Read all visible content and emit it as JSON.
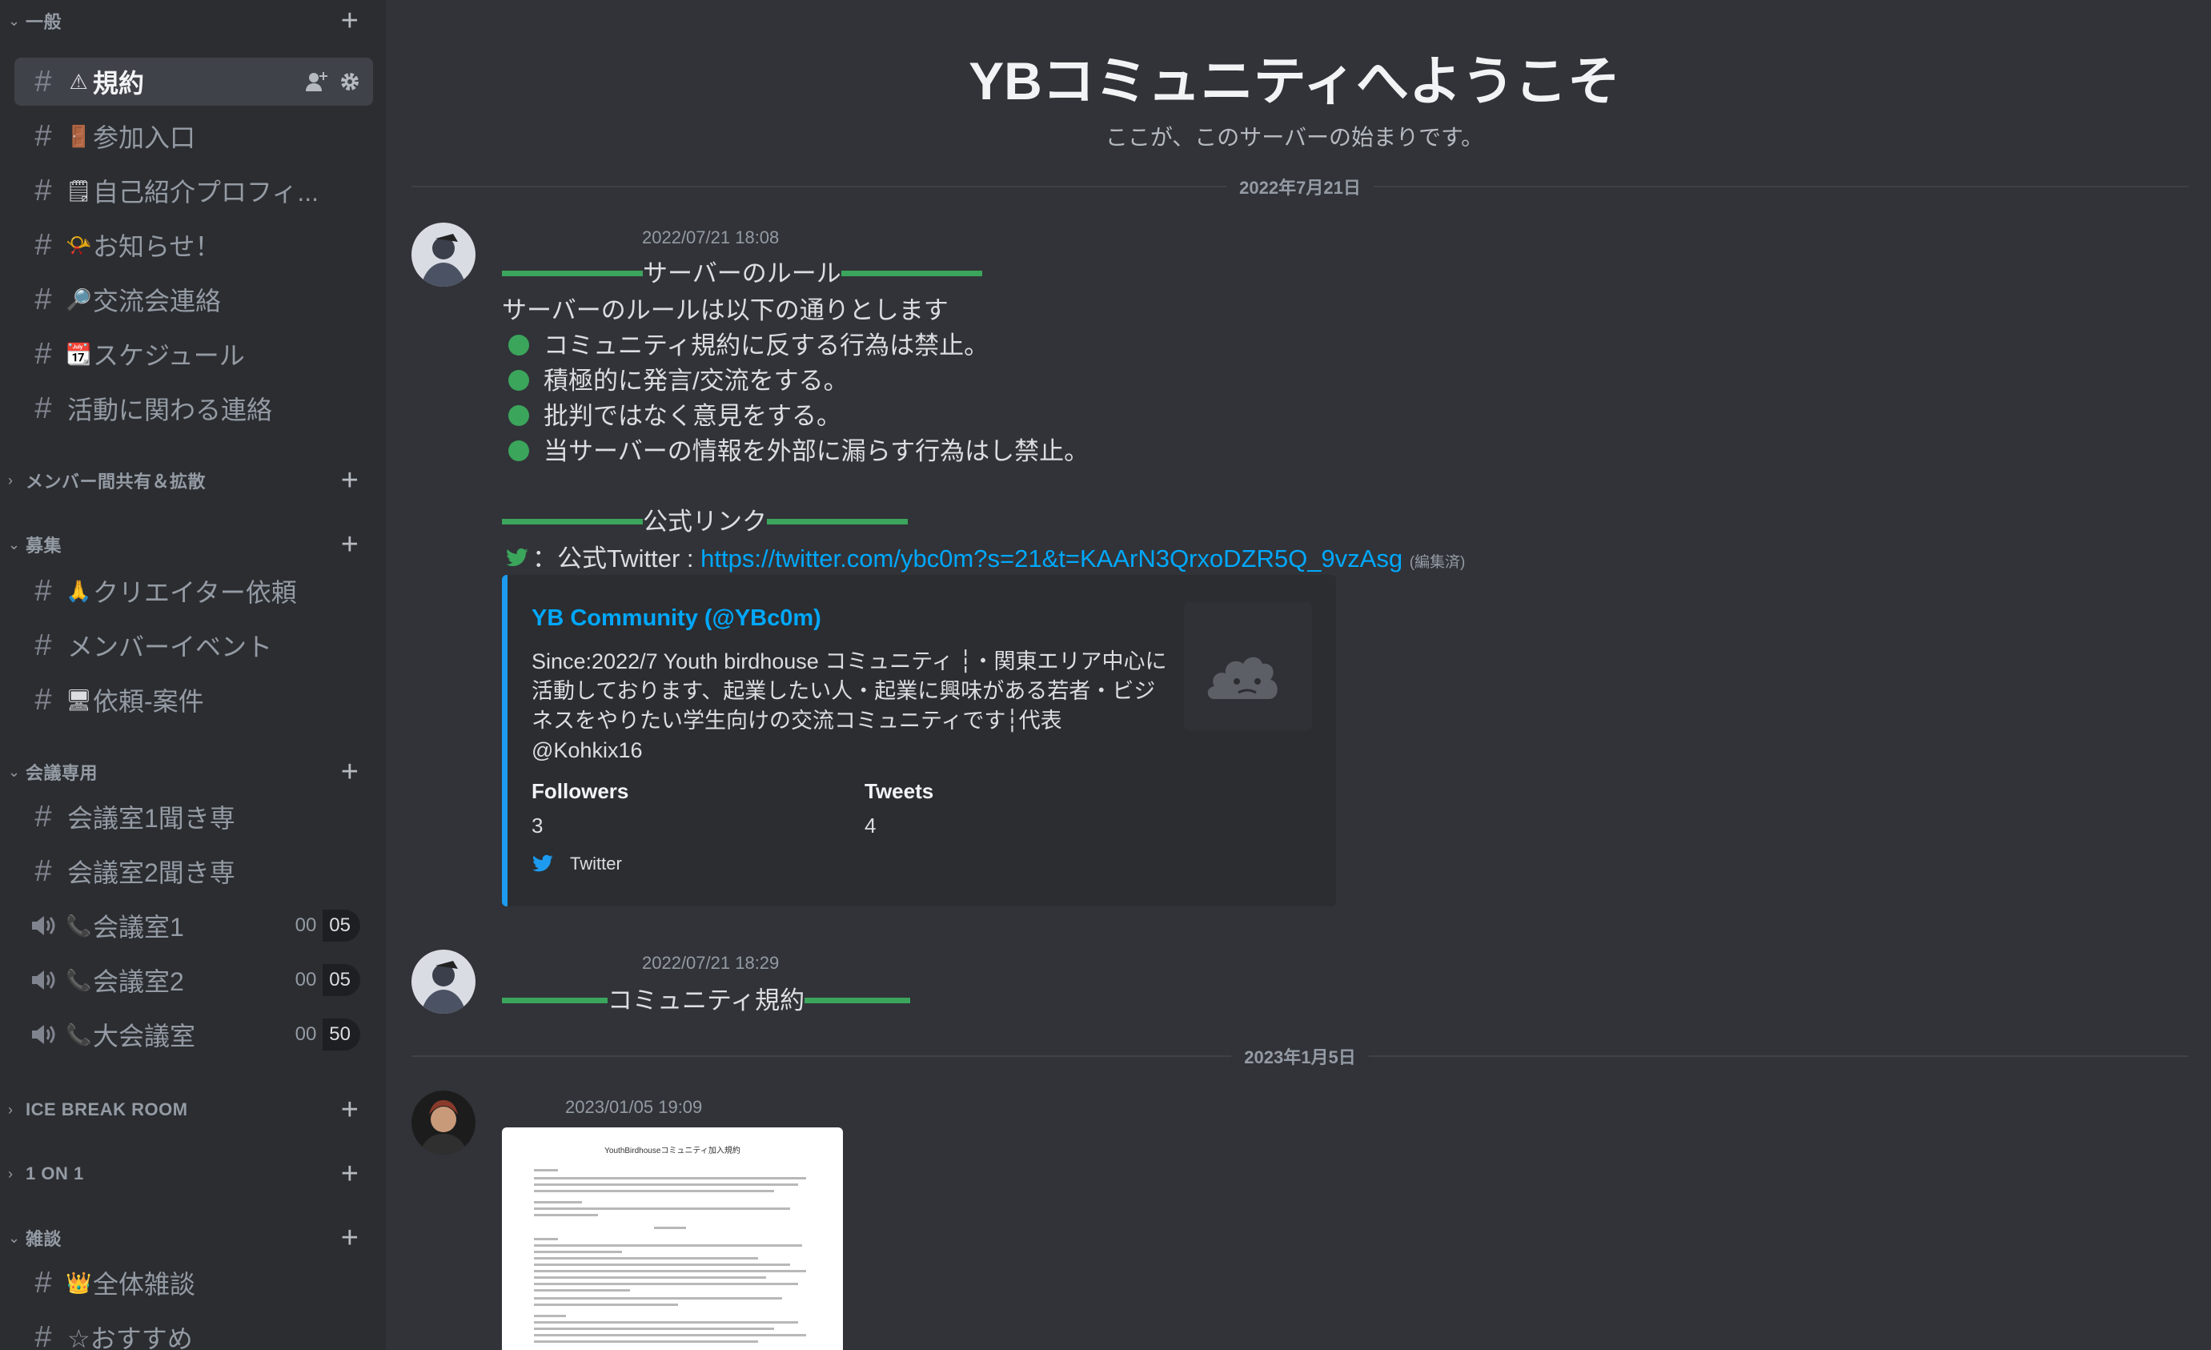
{
  "sidebar": {
    "categories": [
      {
        "label": "一般",
        "chev": "⌄"
      },
      {
        "label": "メンバー間共有＆拡散",
        "chev": "›"
      },
      {
        "label": "募集",
        "chev": "⌄"
      },
      {
        "label": "会議専用",
        "chev": "⌄"
      },
      {
        "label": "ICE BREAK ROOM",
        "chev": "›"
      },
      {
        "label": "1 ON 1",
        "chev": "›"
      },
      {
        "label": "雑談",
        "chev": "⌄"
      }
    ],
    "channels": [
      {
        "emoji": "⚠",
        "label": "規約"
      },
      {
        "emoji": "🚪",
        "label": "参加入口"
      },
      {
        "emoji": "🗒",
        "label": "自己紹介プロフィ..."
      },
      {
        "emoji": "📯",
        "label": "お知らせ！"
      },
      {
        "emoji": "🔎",
        "label": "交流会連絡"
      },
      {
        "emoji": "📆",
        "label": "スケジュール"
      },
      {
        "emoji": "",
        "label": "活動に関わる連絡"
      },
      {
        "emoji": "🙏",
        "label": "クリエイター依頼"
      },
      {
        "emoji": "",
        "label": "メンバーイベント"
      },
      {
        "emoji": "🖥",
        "label": "依頼-案件"
      },
      {
        "emoji": "",
        "label": "会議室1聞き専"
      },
      {
        "emoji": "",
        "label": "会議室2聞き専"
      },
      {
        "emoji": "📞",
        "label": "会議室1",
        "count_a": "00",
        "count_b": "05"
      },
      {
        "emoji": "📞",
        "label": "会議室2",
        "count_a": "00",
        "count_b": "05"
      },
      {
        "emoji": "📞",
        "label": "大会議室",
        "count_a": "00",
        "count_b": "50"
      },
      {
        "emoji": "👑",
        "label": "全体雑談"
      },
      {
        "emoji": "",
        "label": "☆おすすめ"
      }
    ],
    "hash_glyph": "#"
  },
  "main": {
    "welcome_title": "YBコミュニティへようこそ",
    "welcome_sub": "ここが、このサーバーの始まりです。",
    "date_dividers": [
      "2022年7月21日",
      "2023年1月5日"
    ],
    "messages": [
      {
        "timestamp": "2022/07/21 18:08",
        "rules_heading": "サーバーのルール",
        "rules_intro": "サーバーのルールは以下の通りとします",
        "rules": [
          "コミュニティ規約に反する行為は禁止。",
          "積極的に発言/交流をする。",
          "批判ではなく意見をする。",
          "当サーバーの情報を外部に漏らす行為はし禁止。"
        ],
        "links_heading": "公式リンク",
        "twitter_prefix": "：公式Twitter : ",
        "twitter_url": "https://twitter.com/ybc0m?s=21&t=KAArN3QrxoDZR5Q_9vzAsg",
        "edited": "(編集済)",
        "embed": {
          "author": "YB Community (@YBc0m)",
          "description": "Since:2022/7 Youth birdhouse コミュニティ ┆・関東エリア中心に活動しております、起業したい人・起業に興味がある若者・ビジネスをやりたい学生向けの交流コミュニティです┆代表@Kohkix16",
          "field1_name": "Followers",
          "field1_value": "3",
          "field2_name": "Tweets",
          "field2_value": "4",
          "footer": "Twitter"
        }
      },
      {
        "timestamp": "2022/07/21 18:29",
        "heading": "コミュニティ規約"
      },
      {
        "timestamp": "2023/01/05 19:09",
        "doc_title": "YouthBirdhouseコミュニティ加入規約"
      }
    ]
  },
  "colors": {
    "bg": "#313338",
    "sidebar": "#2b2d31",
    "active": "#404249",
    "green": "#3ba55c",
    "link": "#00a8fc",
    "twitter": "#1d9bf0"
  }
}
